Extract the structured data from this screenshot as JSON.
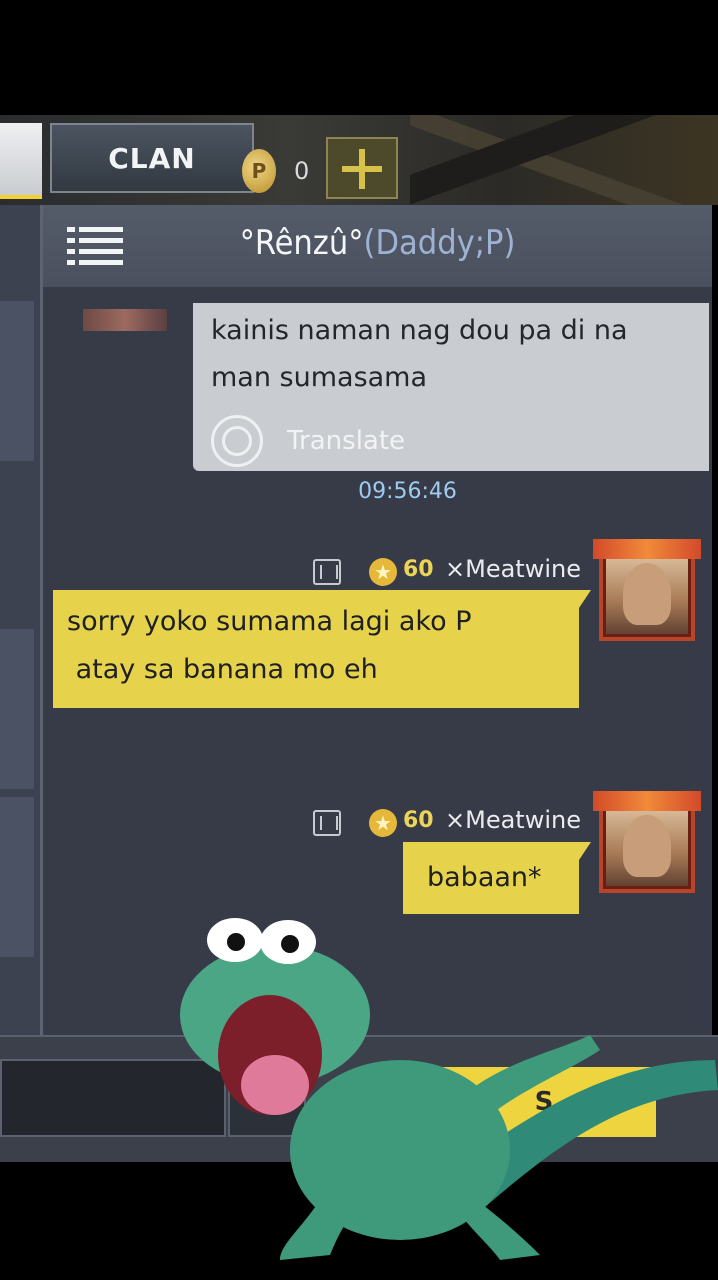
{
  "topbar": {
    "tab_clan_label": "CLAN",
    "coin_symbol": "P",
    "coin_count": "0"
  },
  "chat": {
    "title_name": "°Rênzû°",
    "title_tag": "(Daddy;P)",
    "messages": [
      {
        "direction": "received",
        "lines": [
          "kainis naman nag dou pa di na",
          "man sumasama"
        ],
        "translate_label": "Translate",
        "time": "09:56:46"
      },
      {
        "direction": "sent",
        "sender": "×Meatwine",
        "level": "60",
        "lines": [
          "sorry yoko sumama lagi ako P",
          " atay sa banana mo eh"
        ]
      },
      {
        "direction": "sent",
        "sender": "×Meatwine",
        "level": "60",
        "lines": [
          "babaan*"
        ]
      }
    ]
  },
  "input": {
    "send_label": "S"
  },
  "colors": {
    "accent_yellow": "#e6d24b",
    "panel": "#3b404d",
    "timestamp": "#9ecbf0",
    "title_tag": "#9fb2d4"
  }
}
